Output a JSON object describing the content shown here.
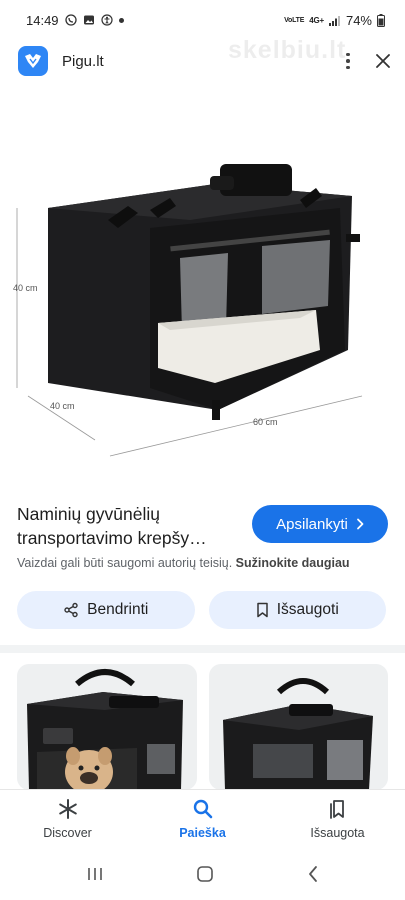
{
  "status_bar": {
    "time": "14:49",
    "network_top": "VoLTE",
    "network_mid": "4G+",
    "battery": "74%"
  },
  "top_bar": {
    "site_name": "Pigu.lt",
    "watermark": "skelbiu.lt"
  },
  "hero": {
    "dim_height": "40 cm",
    "dim_depth": "40 cm",
    "dim_width": "60 cm"
  },
  "result": {
    "title": "Naminių gyvūnėlių\ntransportavimo krepšy…",
    "visit_label": "Apsilankyti",
    "copyright_text": "Vaizdai gali būti saugomi autorių teisių.",
    "learn_more": "Sužinokite daugiau"
  },
  "actions": {
    "share_label": "Bendrinti",
    "save_label": "Išsaugoti"
  },
  "bottom_nav": {
    "items": [
      {
        "label": "Discover",
        "icon": "asterisk-icon"
      },
      {
        "label": "Paieška",
        "icon": "search-icon"
      },
      {
        "label": "Išsaugota",
        "icon": "bookmarks-icon"
      }
    ],
    "active": "Paieška"
  },
  "colors": {
    "accent": "#1a73e8",
    "pill_bg": "#e8f0fe",
    "logo_bg": "#2e86f5"
  }
}
